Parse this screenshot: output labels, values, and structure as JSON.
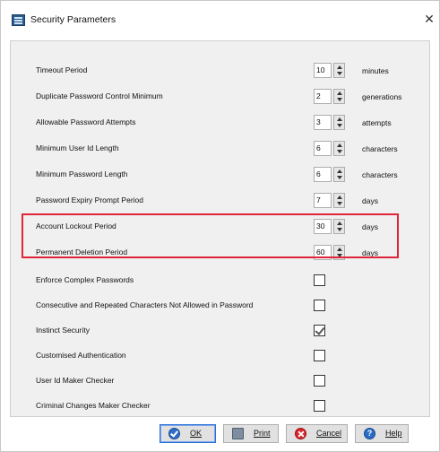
{
  "window": {
    "title": "Security Parameters",
    "close_glyph": "✕",
    "icon": "security-app-icon"
  },
  "numeric_params": [
    {
      "label": "Timeout Period",
      "value": "10",
      "unit": "minutes"
    },
    {
      "label": "Duplicate Password Control Minimum",
      "value": "2",
      "unit": "generations"
    },
    {
      "label": "Allowable Password Attempts",
      "value": "3",
      "unit": "attempts"
    },
    {
      "label": "Minimum User Id Length",
      "value": "6",
      "unit": "characters"
    },
    {
      "label": "Minimum Password Length",
      "value": "6",
      "unit": "characters"
    },
    {
      "label": "Password Expiry Prompt Period",
      "value": "7",
      "unit": "days"
    },
    {
      "label": "Account Lockout Period",
      "value": "30",
      "unit": "days"
    },
    {
      "label": "Permanent Deletion Period",
      "value": "60",
      "unit": "days"
    }
  ],
  "checkbox_params": [
    {
      "label": "Enforce Complex Passwords",
      "checked": false
    },
    {
      "label": "Consecutive and Repeated Characters Not Allowed in Password",
      "checked": false
    },
    {
      "label": "Instinct Security",
      "checked": true
    },
    {
      "label": "Customised Authentication",
      "checked": false
    },
    {
      "label": "User Id Maker Checker",
      "checked": false
    },
    {
      "label": "Criminal Changes Maker Checker",
      "checked": false
    }
  ],
  "highlight": {
    "color": "#e0243a"
  },
  "buttons": {
    "ok": {
      "label": "OK",
      "icon": "ok-icon"
    },
    "print": {
      "label": "Print",
      "icon": "printer-icon"
    },
    "cancel": {
      "label": "Cancel",
      "icon": "cancel-icon"
    },
    "help": {
      "label": "Help",
      "icon": "help-icon",
      "glyph": "?"
    }
  }
}
